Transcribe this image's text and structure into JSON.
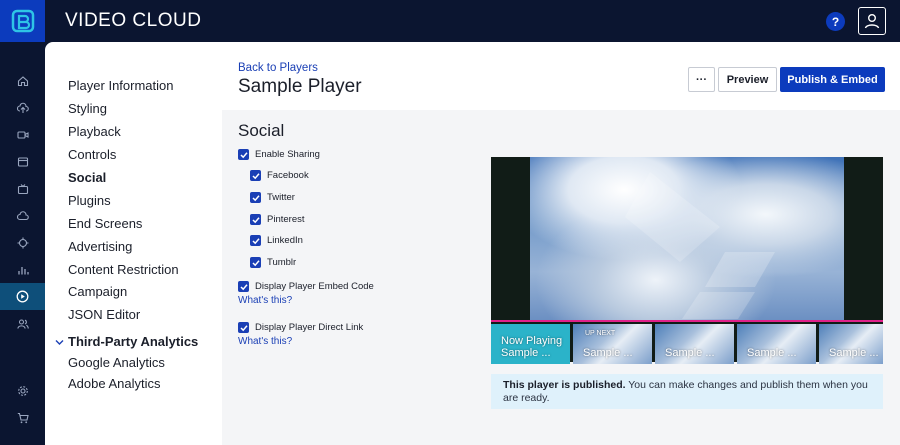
{
  "app": {
    "title": "VIDEO CLOUD"
  },
  "topbar": {
    "help_label": "?"
  },
  "rail": {
    "items": [
      {
        "icon": "home-icon"
      },
      {
        "icon": "upload-icon"
      },
      {
        "icon": "video-camera-icon"
      },
      {
        "icon": "gallery-icon"
      },
      {
        "icon": "live-tv-icon"
      },
      {
        "icon": "cloud-icon"
      },
      {
        "icon": "crosshair-icon"
      },
      {
        "icon": "analytics-icon"
      },
      {
        "icon": "players-icon",
        "active": true
      },
      {
        "icon": "users-icon"
      },
      {
        "icon": "settings-gear-icon"
      },
      {
        "icon": "cart-icon"
      }
    ]
  },
  "nav": {
    "items": [
      {
        "label": "Player Information"
      },
      {
        "label": "Styling"
      },
      {
        "label": "Playback"
      },
      {
        "label": "Controls"
      },
      {
        "label": "Social",
        "active": true
      },
      {
        "label": "Plugins"
      },
      {
        "label": "End Screens"
      },
      {
        "label": "Advertising"
      },
      {
        "label": "Content Restriction"
      },
      {
        "label": "Campaign"
      },
      {
        "label": "JSON Editor"
      }
    ],
    "group": {
      "label": "Third-Party Analytics",
      "expanded": true
    },
    "group_items": [
      {
        "label": "Google Analytics"
      },
      {
        "label": "Adobe Analytics"
      }
    ]
  },
  "header": {
    "back_link": "Back to Players",
    "title": "Sample Player",
    "more_label": "···",
    "preview_label": "Preview",
    "publish_label": "Publish & Embed"
  },
  "social": {
    "section_title": "Social",
    "enable_sharing": {
      "label": "Enable Sharing",
      "checked": true
    },
    "networks": [
      {
        "label": "Facebook",
        "checked": true
      },
      {
        "label": "Twitter",
        "checked": true
      },
      {
        "label": "Pinterest",
        "checked": true
      },
      {
        "label": "LinkedIn",
        "checked": true
      },
      {
        "label": "Tumblr",
        "checked": true
      }
    ],
    "embed_code": {
      "label": "Display Player Embed Code",
      "checked": true,
      "help": "What's this?"
    },
    "direct_link": {
      "label": "Display Player Direct Link",
      "checked": true,
      "help": "What's this?"
    }
  },
  "preview": {
    "playlist": [
      {
        "label": "Now Playing\nSample ...",
        "now": true
      },
      {
        "label": "Sample ...",
        "badge": "UP NEXT"
      },
      {
        "label": "Sample ..."
      },
      {
        "label": "Sample ..."
      },
      {
        "label": "Sample ..."
      }
    ],
    "notice_bold": "This player is published.",
    "notice_text": " You can make changes and publish them when you are ready."
  },
  "colors": {
    "accent": "#0c3bbd",
    "topbar": "#0b1530",
    "playlist_highlight": "#e0208a",
    "notice_bg": "#dff1fb"
  }
}
